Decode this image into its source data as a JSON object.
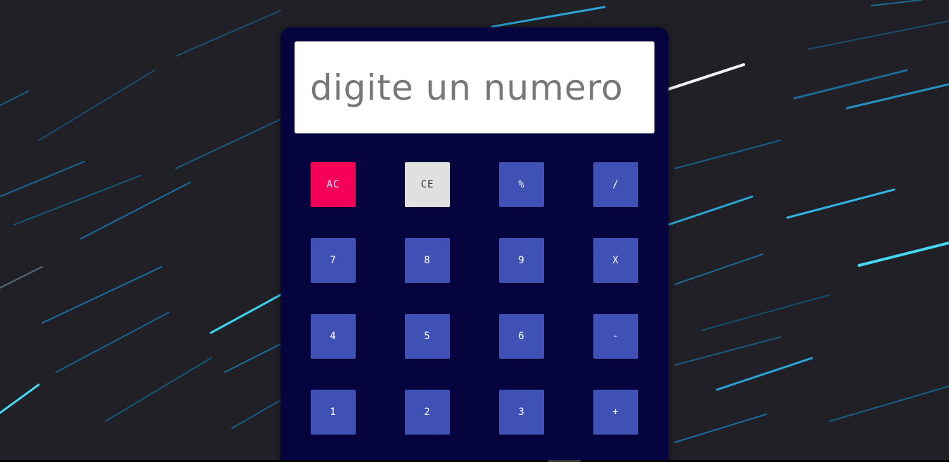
{
  "background": {
    "description_colors": {
      "sky": "#1f1f24",
      "streak_cyan": "#3ad4f0",
      "streak_blue": "#1a6d9c",
      "streak_white": "#f4f4f4"
    }
  },
  "calculator": {
    "body_color": "#06043f",
    "display": {
      "placeholder": "digite un numero",
      "value": ""
    },
    "colors": {
      "number_key": "#3f51b5",
      "clear_all_key": "#f50057",
      "clear_entry_key": "#e0e0e0"
    },
    "keys": {
      "clear_all": "AC",
      "clear_entry": "CE",
      "percent": "%",
      "divide": "/",
      "seven": "7",
      "eight": "8",
      "nine": "9",
      "multiply": "X",
      "four": "4",
      "five": "5",
      "six": "6",
      "subtract": "-",
      "one": "1",
      "two": "2",
      "three": "3",
      "add": "+"
    }
  }
}
